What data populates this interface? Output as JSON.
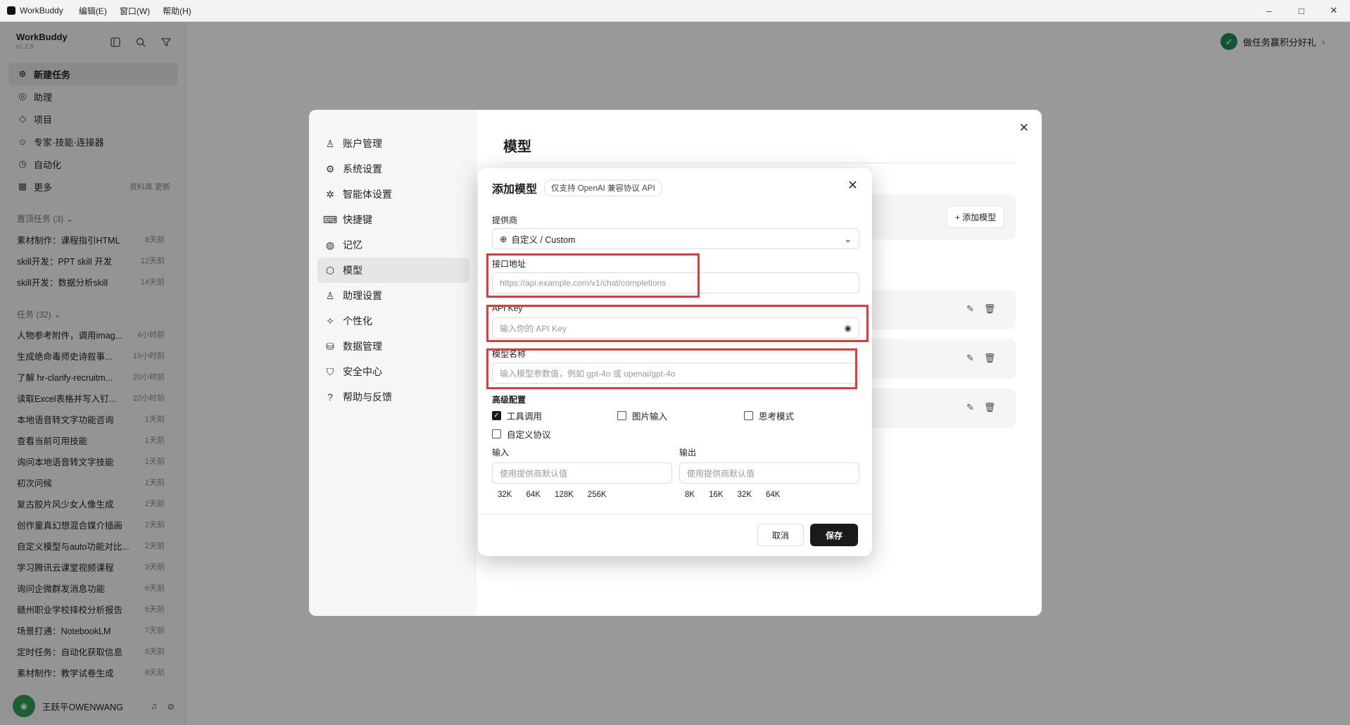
{
  "titlebar": {
    "app_name": "WorkBuddy",
    "menus": [
      "编辑(E)",
      "窗口(W)",
      "帮助(H)"
    ],
    "minimize": "–",
    "maximize": "□",
    "close": "✕"
  },
  "sidebar": {
    "title": "WorkBuddy",
    "version": "v1.2.8",
    "nav": [
      {
        "label": "新建任务",
        "icon": "plus-circle-icon"
      },
      {
        "label": "助理",
        "icon": "robot-icon"
      },
      {
        "label": "项目",
        "icon": "folder-icon"
      },
      {
        "label": "专家·技能·连接器",
        "icon": "expert-icon"
      },
      {
        "label": "自动化",
        "icon": "clock-icon"
      },
      {
        "label": "更多",
        "icon": "grid-icon",
        "extra": "资料库  更新"
      }
    ],
    "pinned_header": "置顶任务 (3)",
    "pinned": [
      {
        "title": "素材制作：课程指引HTML",
        "date": "8天前"
      },
      {
        "title": "skill开发：PPT skill 开发",
        "date": "12天前"
      },
      {
        "title": "skill开发：数据分析skill",
        "date": "14天前"
      }
    ],
    "tasks_header": "任务 (32)",
    "tasks": [
      {
        "title": "人物参考附件，调用imag...",
        "date": "4小时前"
      },
      {
        "title": "生成绝命毒师史诗叙事...",
        "date": "19小时前"
      },
      {
        "title": "了解 hr-clarify-recruitm...",
        "date": "20小时前"
      },
      {
        "title": "读取Excel表格并写入钉...",
        "date": "22小时前"
      },
      {
        "title": "本地语音转文字功能咨询",
        "date": "1天前"
      },
      {
        "title": "查看当前可用技能",
        "date": "1天前"
      },
      {
        "title": "询问本地语音转文字技能",
        "date": "1天前"
      },
      {
        "title": "初次问候",
        "date": "1天前"
      },
      {
        "title": "复古胶片风少女人像生成",
        "date": "2天前"
      },
      {
        "title": "创作童真幻想混合媒介插画",
        "date": "2天前"
      },
      {
        "title": "自定义模型与auto功能对比...",
        "date": "2天前"
      },
      {
        "title": "学习腾讯云课堂视频课程",
        "date": "3天前"
      },
      {
        "title": "询问企微群发消息功能",
        "date": "6天前"
      },
      {
        "title": "赣州职业学校择校分析报告",
        "date": "6天前"
      },
      {
        "title": "场景打通：NotebookLM",
        "date": "7天前"
      },
      {
        "title": "定时任务：自动化获取信息",
        "date": "8天前"
      },
      {
        "title": "素材制作：教学试卷生成",
        "date": "8天前"
      }
    ],
    "user_name": "王跃平OWENWANG"
  },
  "topright": {
    "label": "做任务赢积分好礼"
  },
  "settings": {
    "nav": [
      {
        "label": "账户管理",
        "icon": "user-icon"
      },
      {
        "label": "系统设置",
        "icon": "gear-icon"
      },
      {
        "label": "智能体设置",
        "icon": "agent-icon"
      },
      {
        "label": "快捷键",
        "icon": "keyboard-icon"
      },
      {
        "label": "记忆",
        "icon": "memory-icon"
      },
      {
        "label": "模型",
        "icon": "cube-icon",
        "active": true
      },
      {
        "label": "助理设置",
        "icon": "assistant-icon"
      },
      {
        "label": "个性化",
        "icon": "sparkle-icon"
      },
      {
        "label": "数据管理",
        "icon": "database-icon"
      },
      {
        "label": "安全中心",
        "icon": "shield-icon"
      },
      {
        "label": "帮助与反馈",
        "icon": "help-icon"
      }
    ],
    "title": "模型",
    "add_model": "+ 添加模型"
  },
  "modal": {
    "title": "添加模型",
    "badge": "仅支持 OpenAI 兼容协议 API",
    "provider_label": "提供商",
    "provider_value": "自定义 / Custom",
    "endpoint_label": "接口地址",
    "endpoint_placeholder": "https://api.example.com/v1/chat/completions",
    "apikey_label": "API Key",
    "apikey_placeholder": "输入你的 API Key",
    "modelname_label": "模型名称",
    "modelname_placeholder": "输入模型参数值，例如 gpt-4o 或 openai/gpt-4o",
    "advanced_label": "高级配置",
    "options": [
      {
        "label": "工具调用",
        "checked": true
      },
      {
        "label": "图片输入",
        "checked": false
      },
      {
        "label": "思考模式",
        "checked": false
      },
      {
        "label": "自定义协议",
        "checked": false
      }
    ],
    "input_label": "输入",
    "output_label": "输出",
    "input_placeholder": "使用提供商默认值",
    "output_placeholder": "使用提供商默认值",
    "input_chips": [
      "32K",
      "64K",
      "128K",
      "256K"
    ],
    "output_chips": [
      "8K",
      "16K",
      "32K",
      "64K"
    ],
    "cancel": "取消",
    "save": "保存"
  }
}
